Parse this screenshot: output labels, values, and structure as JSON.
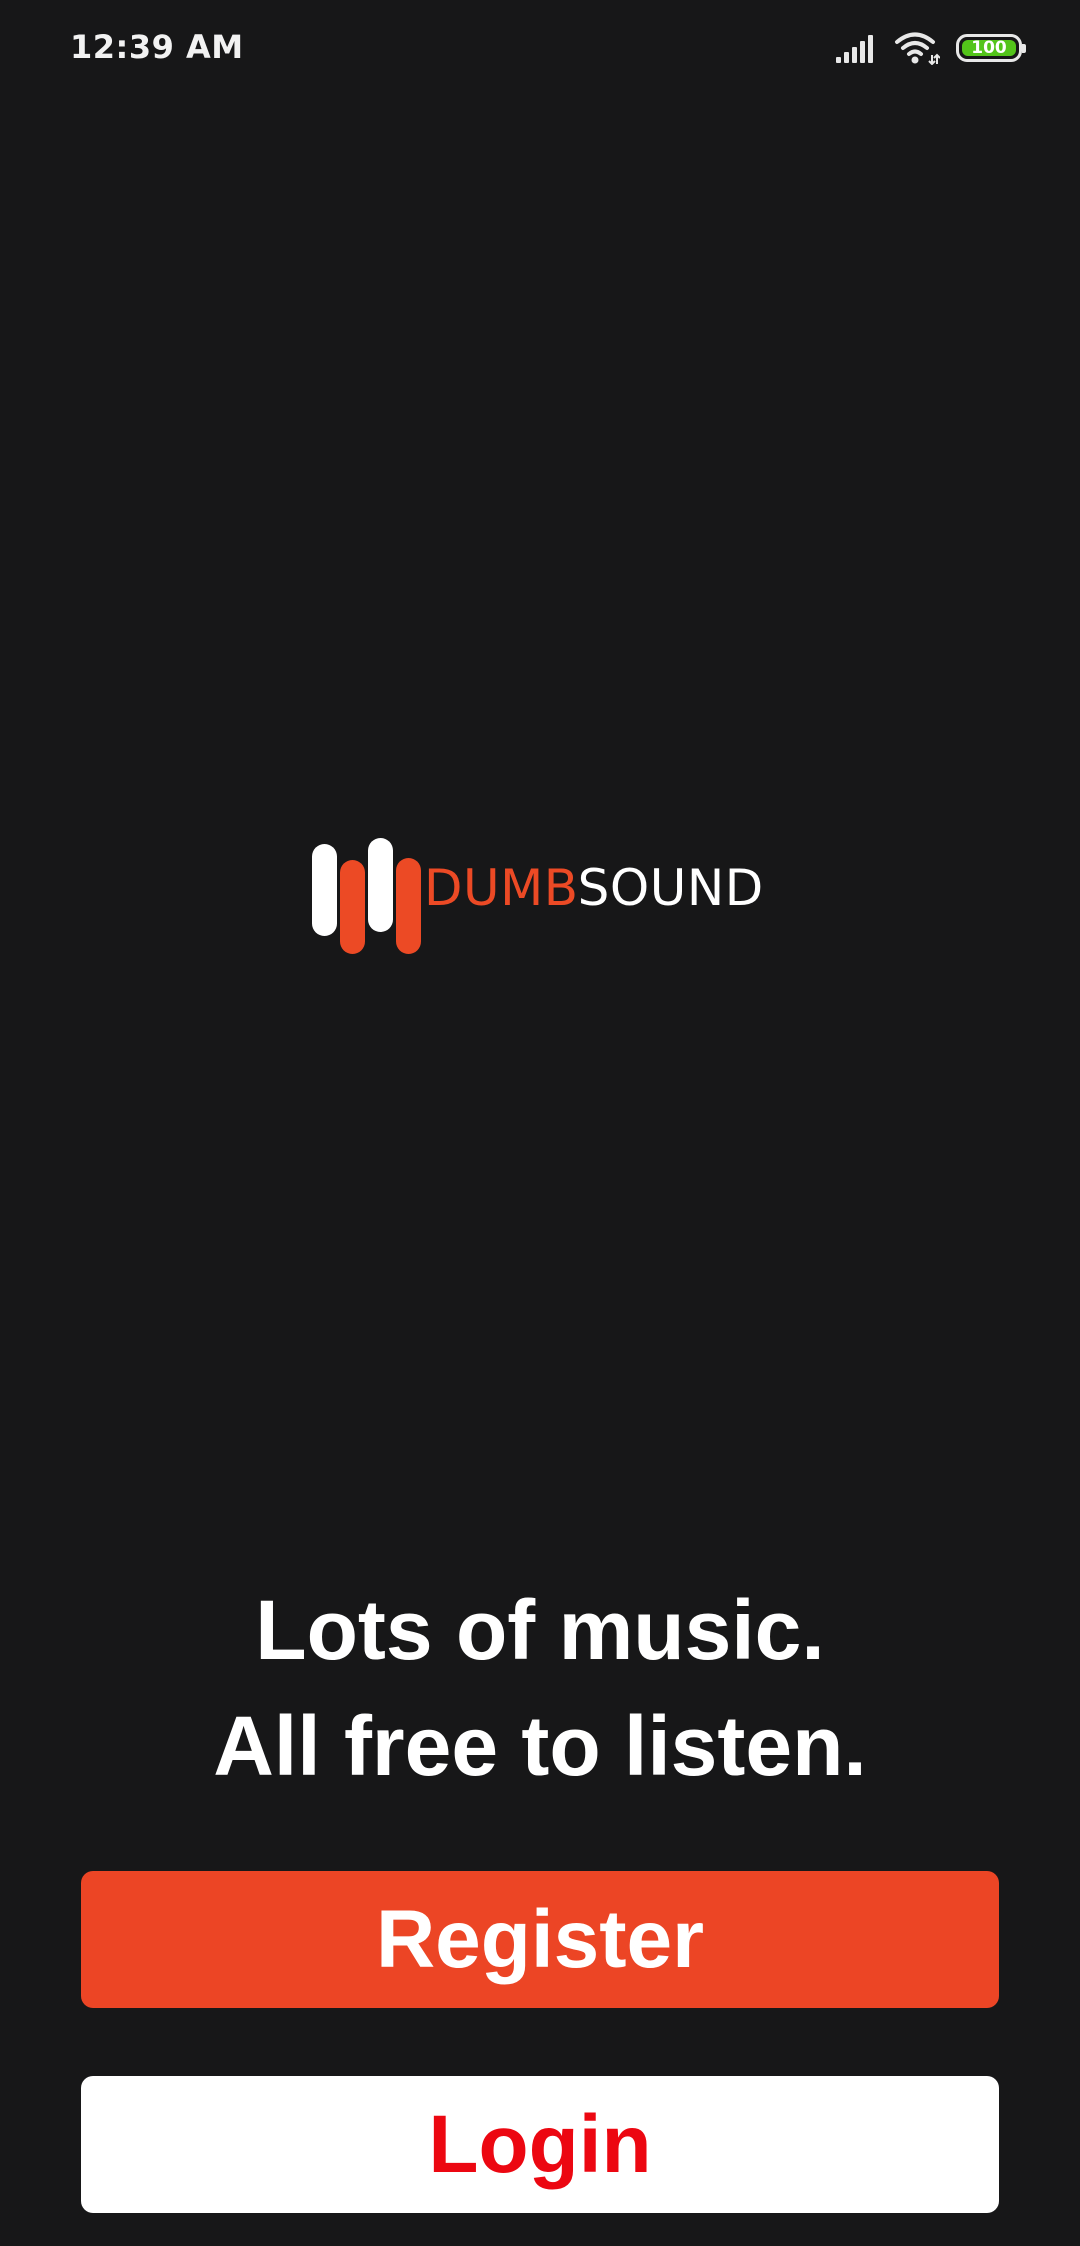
{
  "status_bar": {
    "time": "12:39 AM",
    "battery_level": "100",
    "battery_percent": 100,
    "signal_icon": "signal-icon",
    "wifi_icon": "wifi-icon",
    "battery_icon": "battery-icon"
  },
  "logo": {
    "word_part1": "DUMB",
    "word_part2": "SOUND",
    "icon": "sound-bars-logo-icon"
  },
  "tagline": {
    "line1": "Lots of music.",
    "line2": "All free to listen."
  },
  "buttons": {
    "register_label": "Register",
    "login_label": "Login"
  },
  "colors": {
    "background": "#171718",
    "accent": "#ec4525",
    "login_text": "#ec0711",
    "battery_green": "#53c41a"
  }
}
